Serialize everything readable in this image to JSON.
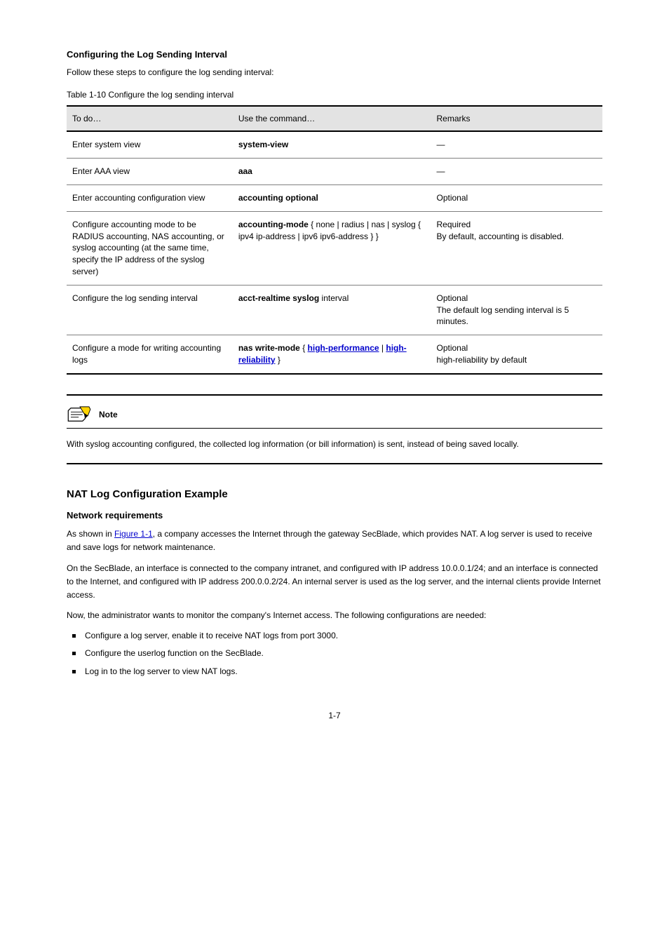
{
  "subsection_title": "Configuring the Log Sending Interval",
  "intro_text": "Follow these steps to configure the log sending interval:",
  "table_caption": "Table 1-10 Configure the log sending interval",
  "table": {
    "headers": [
      "To do…",
      "Use the command…",
      "Remarks"
    ],
    "rows": [
      {
        "todo": "Enter system view",
        "cmd_bold": "system-view",
        "cmd_rest": "",
        "remarks": "—"
      },
      {
        "todo": "Enter AAA view",
        "cmd_bold": "aaa",
        "cmd_rest": "",
        "remarks": "—"
      },
      {
        "todo": "Enter accounting configuration view",
        "cmd_bold": "accounting optional",
        "cmd_rest": "",
        "remarks": "Optional"
      },
      {
        "todo": "Configure accounting mode to be RADIUS accounting, NAS accounting, or syslog accounting (at the same time, specify the IP address of the syslog server)",
        "cmd_bold": "accounting-mode",
        "cmd_rest": " { none | radius | nas | syslog { ipv4 ip-address | ipv6 ipv6-address } }",
        "remarks": "Required\nBy default, accounting is disabled."
      },
      {
        "todo": "Configure the log sending interval",
        "cmd_bold": "acct-realtime syslog",
        "cmd_rest": " interval",
        "remarks": "Optional\nThe default log sending interval is 5 minutes."
      },
      {
        "todo": "Configure a mode for writing accounting logs",
        "cmd_bold": "nas write-mode",
        "cmd_rest": " { ",
        "cmd_link1": "high-performance",
        "cmd_mid": " | ",
        "cmd_link2": "high-reliability",
        "cmd_end": " }",
        "remarks": "Optional\nhigh-reliability by default"
      }
    ]
  },
  "note_label": "Note",
  "note_body": "With syslog accounting configured, the collected log information (or bill information) is sent, instead of being saved locally.",
  "section_title": "NAT Log Configuration Example",
  "network_req_title": "Network requirements",
  "para1_prefix": "As shown in ",
  "para1_link": "Figure 1-1",
  "para1_rest": ", a company accesses the Internet through the gateway SecBlade, which provides NAT. A log server is used to receive and save logs for network maintenance.",
  "para2": "On the SecBlade, an interface is connected to the company intranet, and configured with IP address 10.0.0.1/24; and an interface is connected to the Internet, and configured with IP address 200.0.0.2/24. An internal server is used as the log server, and the internal clients provide Internet access.",
  "para3": "Now, the administrator wants to monitor the company's Internet access. The following configurations are needed:",
  "bullets": [
    "Configure a log server, enable it to receive NAT logs from port 3000.",
    "Configure the userlog function on the SecBlade.",
    "Log in to the log server to view NAT logs."
  ],
  "page_number": "1-7"
}
